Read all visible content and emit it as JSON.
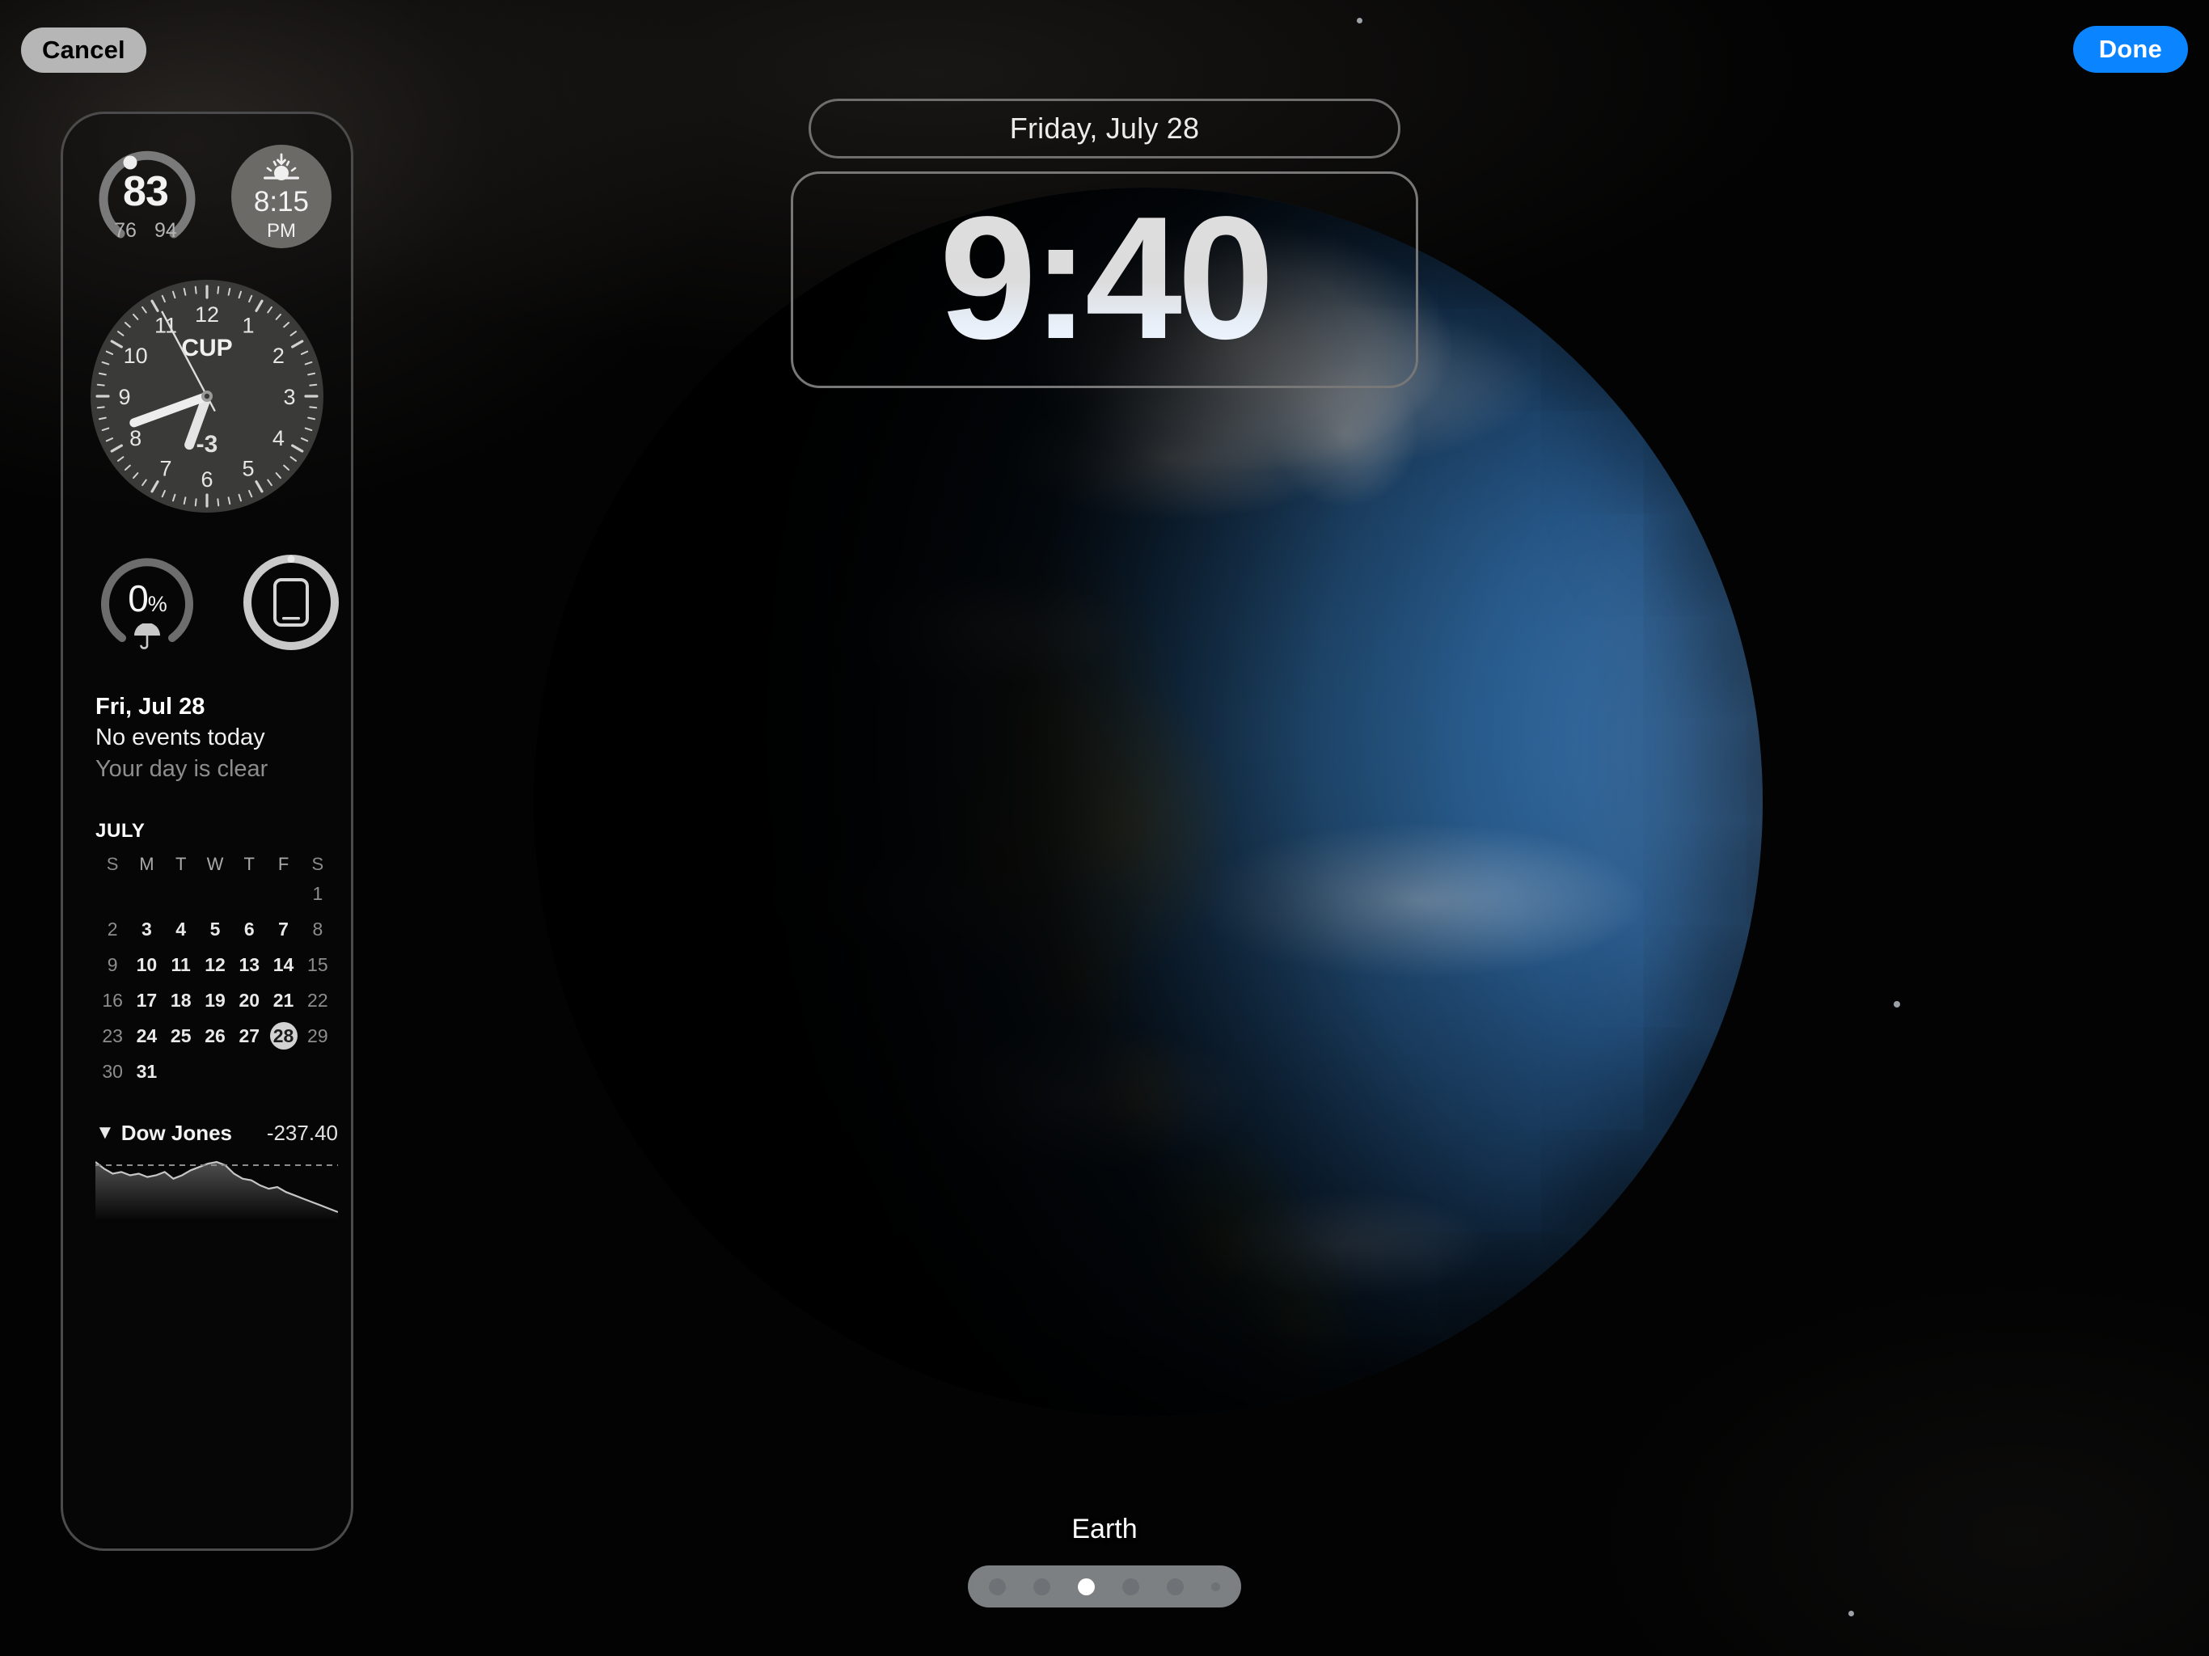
{
  "toolbar": {
    "cancel_label": "Cancel",
    "done_label": "Done"
  },
  "clock": {
    "date": "Friday, July 28",
    "time": "9:40"
  },
  "wallpaper": {
    "name": "Earth"
  },
  "page_indicator": {
    "count": 6,
    "active_index": 2
  },
  "widgets": {
    "temperature": {
      "value": "83",
      "low": "76",
      "high": "94",
      "progress_percent": 52
    },
    "sunset": {
      "time": "8:15",
      "period": "PM",
      "icon": "sunset-icon"
    },
    "world_clock": {
      "city_code": "CUP",
      "offset_label": "-3",
      "numerals": [
        "12",
        "1",
        "2",
        "3",
        "4",
        "5",
        "6",
        "7",
        "8",
        "9",
        "10",
        "11"
      ],
      "hour_angle": 200,
      "minute_angle": 250,
      "second_angle": 332
    },
    "rain": {
      "value": "0",
      "unit": "%",
      "icon": "umbrella-icon",
      "progress_percent": 0
    },
    "battery": {
      "icon": "ipad-icon",
      "progress_percent": 97
    },
    "calendar_event": {
      "date": "Fri, Jul 28",
      "title": "No events today",
      "subtitle": "Your day is clear"
    },
    "month_calendar": {
      "month_label": "JULY",
      "weekday_headers": [
        "S",
        "M",
        "T",
        "W",
        "T",
        "F",
        "S"
      ],
      "leading_blanks": 6,
      "days_in_month": 31,
      "today": 28
    },
    "stocks": {
      "direction_icon": "triangle-down-icon",
      "name": "Dow Jones",
      "change": "-237.40",
      "series": [
        100,
        96,
        93,
        94,
        92,
        93,
        91,
        92,
        94,
        90,
        92,
        95,
        97,
        99,
        100,
        98,
        93,
        90,
        89,
        86,
        84,
        85,
        82,
        80,
        78,
        76,
        74,
        72,
        70
      ]
    }
  },
  "colors": {
    "accent": "#0a84ff",
    "cancel_bg": "#b6b6b6",
    "panel_border": "#4b4b4b",
    "today_highlight": "#d2d2d2"
  }
}
